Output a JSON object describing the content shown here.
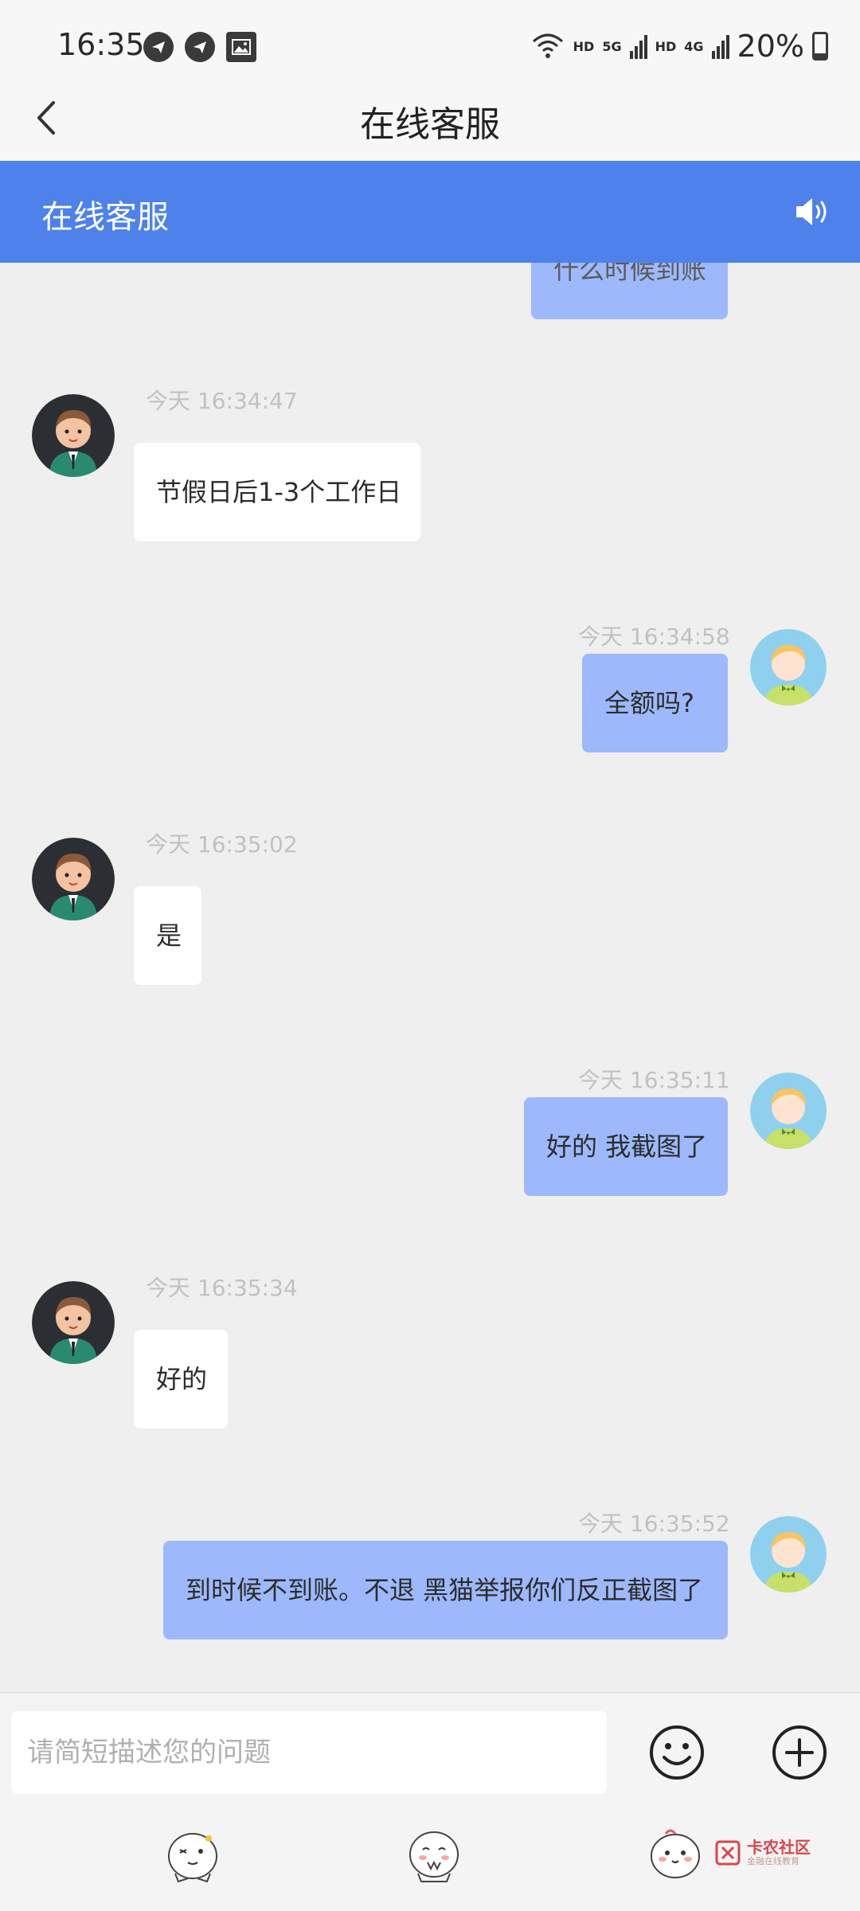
{
  "status_bar": {
    "time": "16:35",
    "network_1": "HD",
    "network_1_type": "5G",
    "network_2": "HD",
    "network_2_type": "4G",
    "battery": "20%"
  },
  "nav": {
    "title": "在线客服"
  },
  "chat_header": {
    "title": "在线客服"
  },
  "messages": [
    {
      "sender": "user",
      "text": "什么时候到账",
      "time": ""
    },
    {
      "sender": "agent",
      "text": "节假日后1-3个工作日",
      "time": "今天 16:34:47"
    },
    {
      "sender": "user",
      "text": "全额吗?",
      "time": "今天 16:34:58"
    },
    {
      "sender": "agent",
      "text": "是",
      "time": "今天 16:35:02"
    },
    {
      "sender": "user",
      "text": "好的 我截图了",
      "time": "今天 16:35:11"
    },
    {
      "sender": "agent",
      "text": "好的",
      "time": "今天 16:35:34"
    },
    {
      "sender": "user",
      "text": "到时候不到账。不退 黑猫举报你们反正截图了",
      "time": "今天 16:35:52"
    }
  ],
  "input": {
    "placeholder": "请简短描述您的问题",
    "value": ""
  },
  "watermark": {
    "main": "卡农社区",
    "sub": "金融在线教育"
  },
  "colors": {
    "header_blue": "#4e82ea",
    "user_bubble": "#9db9fb",
    "agent_bubble": "#ffffff",
    "background": "#efefef"
  },
  "icons": [
    "back-arrow-icon",
    "speaker-icon",
    "emoji-icon",
    "plus-icon",
    "wifi-icon",
    "battery-icon",
    "sticker-icon"
  ]
}
